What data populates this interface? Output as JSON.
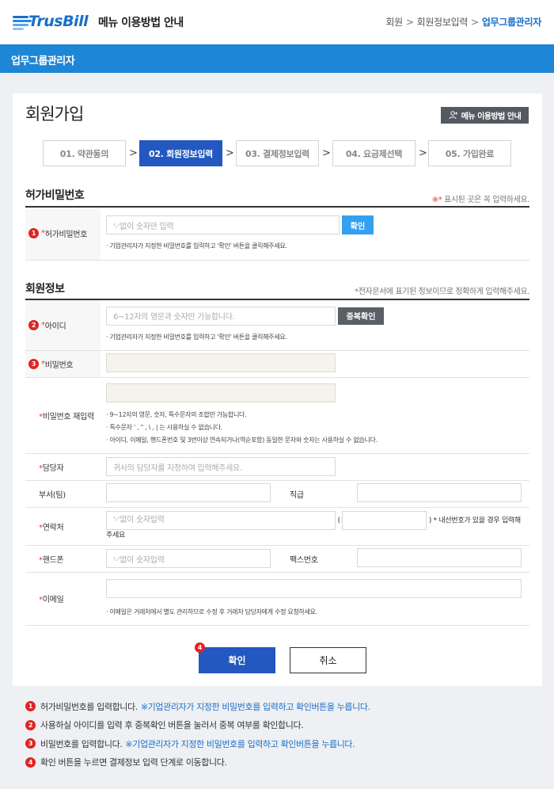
{
  "header": {
    "logo_text": "TrusBill",
    "page_name": "메뉴 이용방법 안내",
    "breadcrumb": [
      "회원",
      "회원정보입력",
      "업무그룹관리자"
    ],
    "breadcrumb_sep": ">"
  },
  "bluebar": {
    "title": "업무그룹관리자"
  },
  "card": {
    "title": "회원가입",
    "guide_button": "메뉴 이용방법 안내"
  },
  "steps": [
    {
      "label": "01. 약관동의",
      "active": false
    },
    {
      "label": "02. 회원정보입력",
      "active": true
    },
    {
      "label": "03. 결제정보입력",
      "active": false
    },
    {
      "label": "04. 요금제선택",
      "active": false
    },
    {
      "label": "05. 가입완료",
      "active": false
    }
  ],
  "step_arrow": ">",
  "temp_pw": {
    "section_title": "허가비밀번호",
    "note_star": "※*",
    "note_text": " 표시된 곳은 꼭 입력하세요.",
    "label": "허가비밀번호",
    "badge": "1",
    "placeholder": "'-'없이 숫자만 입력",
    "button": "확인",
    "hint": "· 기업관리자가 지정한 비밀번호를 입력하고 '확인' 버튼을 클릭해주세요."
  },
  "member": {
    "section_title": "회원정보",
    "note": "*전자문서에 표기된 정보이므로 정확하게 입력해주세요.",
    "id_label": "아이디",
    "id_badge": "2",
    "id_placeholder": "6~12자의 영문과 숫자만 가능합니다.",
    "id_button": "중복확인",
    "id_hint": "· 기업관리자가 지정한 비밀번호를 입력하고 '확인' 버튼을 클릭해주세요.",
    "pw_label": "비밀번호",
    "pw_badge": "3",
    "pw2_label": "비밀번호 재입력",
    "pw2_hints": [
      "· 9~12자의 영문, 숫자, 특수문자의 조합만 가능합니다.",
      "· 특수문자 ' , \" , \\ , | 는 사용하실 수 없습니다.",
      "· 아이디, 이메일, 핸드폰번호 및 3번이상 연속되거나(역순포함) 동일한 문자와 숫자는 사용하실 수 없습니다."
    ],
    "manager_label": "담당자",
    "manager_placeholder": "귀사의 담당자를 지정하여 입력해주세요.",
    "dept_label": "부서(팀)",
    "rank_label": "직급",
    "contact_label": "연락처",
    "contact_placeholder": "'-'없이 숫자입력",
    "contact_paren_open": "(",
    "contact_note": ") * 내선번호가 있을 경우 입력해주세요",
    "mobile_label": "핸드폰",
    "mobile_placeholder": "'-'없이 숫자입력",
    "fax_label": "팩스번호",
    "email_label": "이메일",
    "email_hint": "· 이메일은 거래처에서 별도 관리하므로 수정 후 거래처 담당자에게 수정 요청하세요."
  },
  "actions": {
    "confirm": "확인",
    "cancel": "취소",
    "confirm_badge": "4"
  },
  "notes": [
    {
      "num": "1",
      "text": "허가비밀번호를 입력합니다.",
      "highlight": "※기업관리자가 지정한 비밀번호를 입력하고 확인버튼을 누릅니다."
    },
    {
      "num": "2",
      "text": "사용하실 아이디를 입력 후 중복확인 버튼을 눌러서 중복 여부를 확인합니다.",
      "highlight": ""
    },
    {
      "num": "3",
      "text": "비밀번호를 입력합니다.",
      "highlight": "※기업관리자가 지정한 비밀번호를 입력하고 확인버튼을 누릅니다."
    },
    {
      "num": "4",
      "text": "확인 버튼을 누르면 결제정보 입력 단계로 이동합니다.",
      "highlight": ""
    }
  ],
  "colors": {
    "brand_blue": "#1e86d6",
    "step_active": "#2258c0",
    "required": "#e03a3a",
    "badge": "#e02424"
  }
}
